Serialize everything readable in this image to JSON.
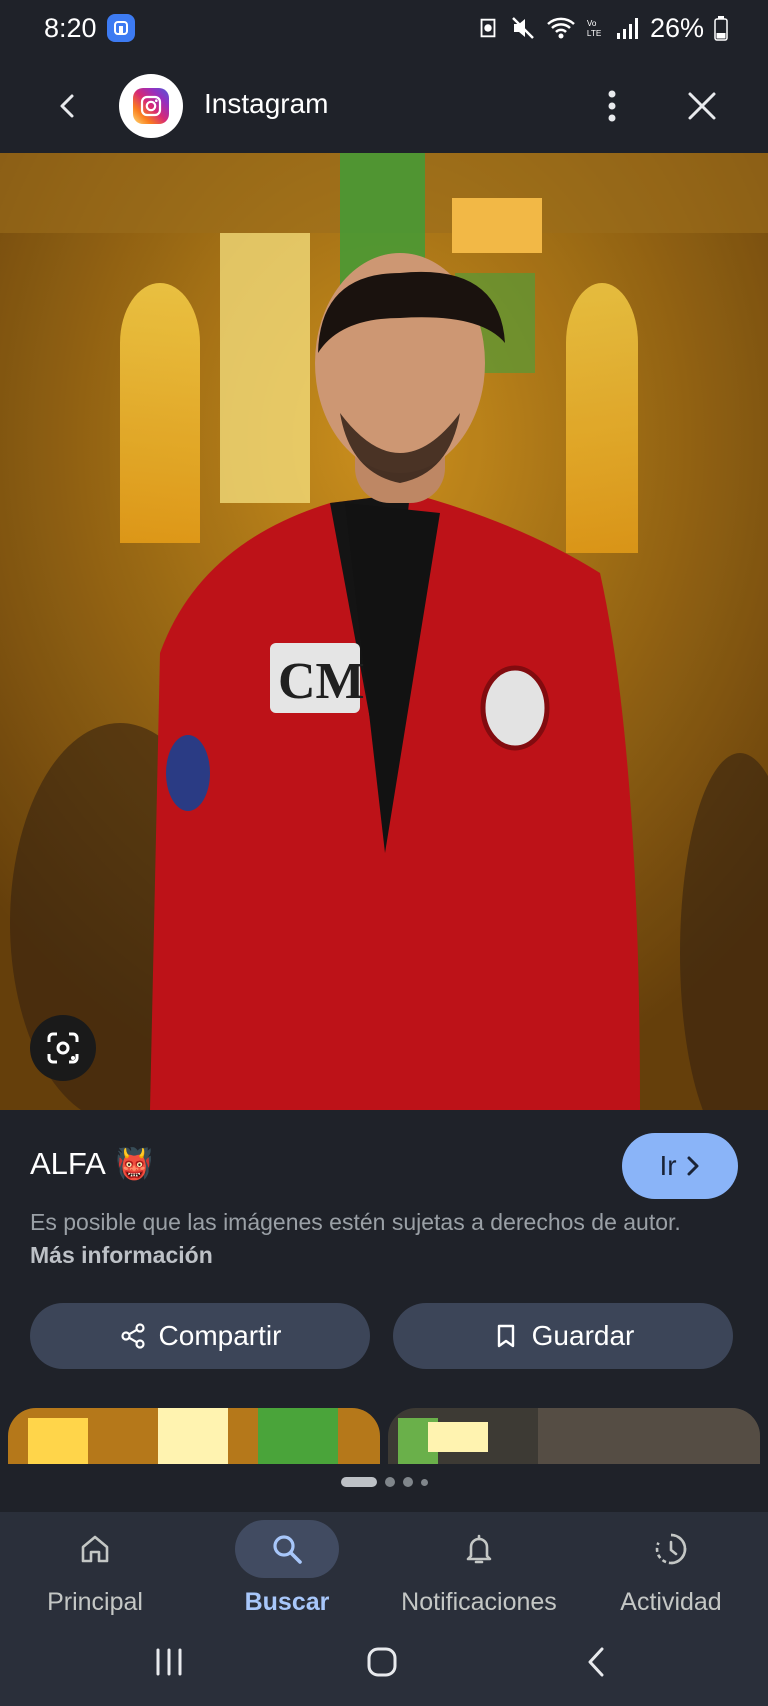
{
  "status_bar": {
    "time": "8:20",
    "battery": "26%",
    "icons": [
      "app-badge-icon",
      "data-saver-icon",
      "mute-icon",
      "wifi-icon",
      "volte-icon",
      "signal-icon",
      "battery-icon"
    ]
  },
  "header": {
    "title": "Instagram",
    "icons": [
      "back-arrow-icon",
      "instagram-logo-icon",
      "more-vert-icon",
      "close-icon"
    ]
  },
  "image_viewer": {
    "lens_icon": "google-lens-icon"
  },
  "result": {
    "title": "ALFA",
    "emoji": "👹",
    "go_label": "Ir",
    "notice_text": "Es posible que las imágenes estén sujetas a derechos de autor.",
    "more_info_link": "Más información"
  },
  "actions": {
    "share_label": "Compartir",
    "save_label": "Guardar"
  },
  "bottom_nav": {
    "items": [
      {
        "label": "Principal",
        "icon": "home-icon"
      },
      {
        "label": "Buscar",
        "icon": "search-icon",
        "active": true
      },
      {
        "label": "Notificaciones",
        "icon": "bell-icon"
      },
      {
        "label": "Actividad",
        "icon": "activity-icon"
      }
    ]
  },
  "colors": {
    "background": "#1f2229",
    "accent": "#8ab4f8",
    "pill": "#3c4558",
    "nav_background": "#2a2f3a"
  }
}
